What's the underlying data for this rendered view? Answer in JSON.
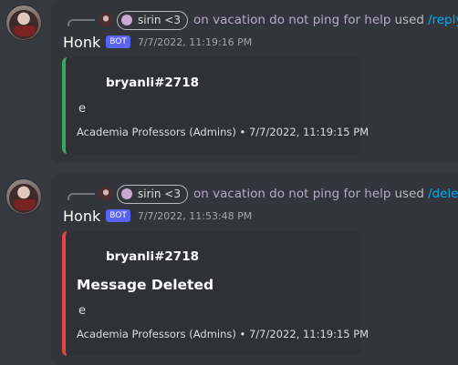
{
  "colors": {
    "background": "#36393f",
    "message_hover": "#32353b",
    "embed_bg": "#2f3136",
    "embed1_accent": "#3ba55d",
    "embed2_accent": "#ed4245",
    "bot_tag": "#5865f2",
    "link": "#00aff4"
  },
  "messages": [
    {
      "reply": {
        "user": "sirin <3",
        "status_text": "on vacation do not ping for help",
        "used_label": "used",
        "command": "/reply"
      },
      "author": "Honk",
      "bot_label": "BOT",
      "timestamp": "7/7/2022, 11:19:16 PM",
      "embed": {
        "author": "bryanli#2718",
        "title": "",
        "description": "e",
        "footer": "Academia Professors (Admins) • 7/7/2022, 11:19:15 PM"
      }
    },
    {
      "reply": {
        "user": "sirin <3",
        "status_text": "on vacation do not ping for help",
        "used_label": "used",
        "command": "/delete"
      },
      "author": "Honk",
      "bot_label": "BOT",
      "timestamp": "7/7/2022, 11:53:48 PM",
      "embed": {
        "author": "bryanli#2718",
        "title": "Message Deleted",
        "description": "e",
        "footer": "Academia Professors (Admins) • 7/7/2022, 11:19:15 PM"
      }
    }
  ]
}
